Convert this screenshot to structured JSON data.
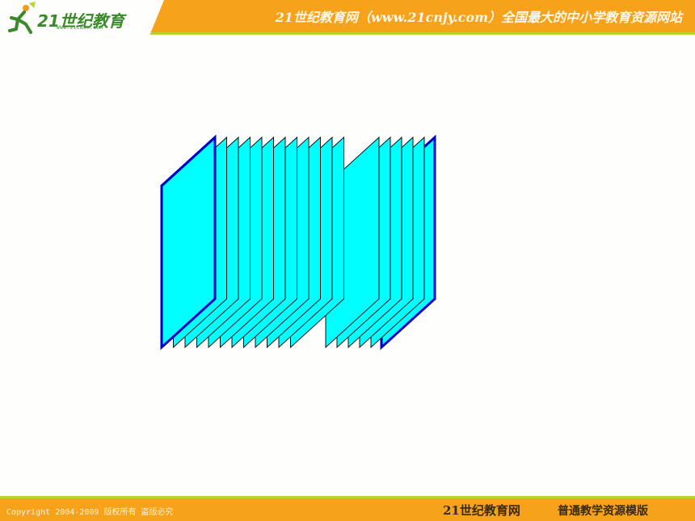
{
  "header": {
    "logo_text": "21世纪教育",
    "logo_sub": "WWW.21CNJY.COM",
    "title": "21世纪教育网（www.21cnjy.com）全国最大的中小学教育资源网站"
  },
  "footer": {
    "copyright": "Copyright 2004-2009 版权所有 盗版必究",
    "brand": "21世纪教育网",
    "template": "普通教学资源模版"
  },
  "colors": {
    "orange": "#f7a21b",
    "green": "#b8d431",
    "cyan": "#00ffff",
    "blue": "#0000cc"
  }
}
